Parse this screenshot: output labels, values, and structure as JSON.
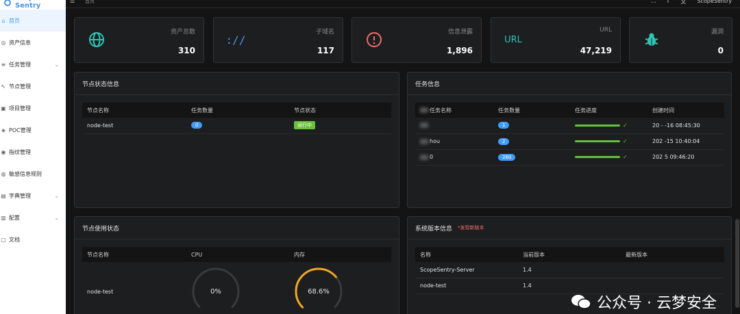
{
  "brand": {
    "title": "Scope Sentry"
  },
  "sidebar": {
    "items": [
      {
        "label": "首页",
        "icon": "home-icon",
        "glyph": "⌂",
        "active": true,
        "expand": false
      },
      {
        "label": "资产信息",
        "icon": "asset-icon",
        "glyph": "◎",
        "active": false,
        "expand": false
      },
      {
        "label": "任务管理",
        "icon": "task-icon",
        "glyph": "≡",
        "active": false,
        "expand": true
      },
      {
        "label": "节点管理",
        "icon": "node-icon",
        "glyph": "↖",
        "active": false,
        "expand": false
      },
      {
        "label": "项目管理",
        "icon": "project-icon",
        "glyph": "▣",
        "active": false,
        "expand": false
      },
      {
        "label": "POC管理",
        "icon": "poc-icon",
        "glyph": "◈",
        "active": false,
        "expand": false
      },
      {
        "label": "指纹管理",
        "icon": "fingerprint-icon",
        "glyph": "◉",
        "active": false,
        "expand": false
      },
      {
        "label": "敏感信息规则",
        "icon": "rule-icon",
        "glyph": "◍",
        "active": false,
        "expand": false
      },
      {
        "label": "字典管理",
        "icon": "dict-icon",
        "glyph": "▤",
        "active": false,
        "expand": true
      },
      {
        "label": "配置",
        "icon": "config-icon",
        "glyph": "▥",
        "active": false,
        "expand": true
      },
      {
        "label": "文档",
        "icon": "doc-icon",
        "glyph": "▢",
        "active": false,
        "expand": false
      }
    ]
  },
  "topbar": {
    "breadcrumb": "首页",
    "user": "ScopeSentry"
  },
  "stats": [
    {
      "label": "资产总数",
      "value": "310",
      "icon": "globe-icon",
      "color": "#2ec4b6"
    },
    {
      "label": "子域名",
      "value": "117",
      "icon": "link-icon",
      "color": "#4a90e2"
    },
    {
      "label": "信息泄露",
      "value": "1,896",
      "icon": "warning-icon",
      "color": "#f56c6c"
    },
    {
      "label": "URL",
      "value": "47,219",
      "icon": "url-icon",
      "iconText": "URL",
      "color": "#2ec4b6"
    },
    {
      "label": "漏洞",
      "value": "0",
      "icon": "bug-icon",
      "color": "#2ec4b6"
    }
  ],
  "node_status": {
    "title": "节点状态信息",
    "headers": [
      "节点名称",
      "任务数量",
      "节点状态"
    ],
    "rows": [
      {
        "name": "node-test",
        "count": "0",
        "status": "运行中"
      }
    ]
  },
  "task_info": {
    "title": "任务信息",
    "headers": [
      "任务名称",
      "任务数量",
      "任务进度",
      "创建时间"
    ],
    "rows": [
      {
        "name": "",
        "count": "1",
        "progress": 1.0,
        "time": "20  -  -16 08:45:30"
      },
      {
        "name": "hou",
        "count": "2",
        "progress": 1.0,
        "time": "202  -15 10:40:04"
      },
      {
        "name": "0",
        "count": "260",
        "progress": 1.0,
        "time": "202   5 09:46:20"
      }
    ]
  },
  "node_usage": {
    "title": "节点使用状态",
    "headers": [
      "节点名称",
      "CPU",
      "内存"
    ],
    "rows": [
      {
        "name": "node-test",
        "cpu": "0%",
        "cpu_value": 0,
        "mem": "68.6%",
        "mem_value": 68.6
      }
    ],
    "colors": {
      "track": "#3a3a3a",
      "mem": "#f5a623"
    }
  },
  "version_info": {
    "title": "系统版本信息",
    "note": "*发现新版本",
    "headers": [
      "名称",
      "当前版本",
      "最新版本"
    ],
    "rows": [
      {
        "name": "ScopeSentry-Server",
        "current": "1.4",
        "latest": ""
      },
      {
        "name": "node-test",
        "current": "1.4",
        "latest": ""
      }
    ]
  },
  "watermark": {
    "text": "公众号 · 云梦安全"
  }
}
